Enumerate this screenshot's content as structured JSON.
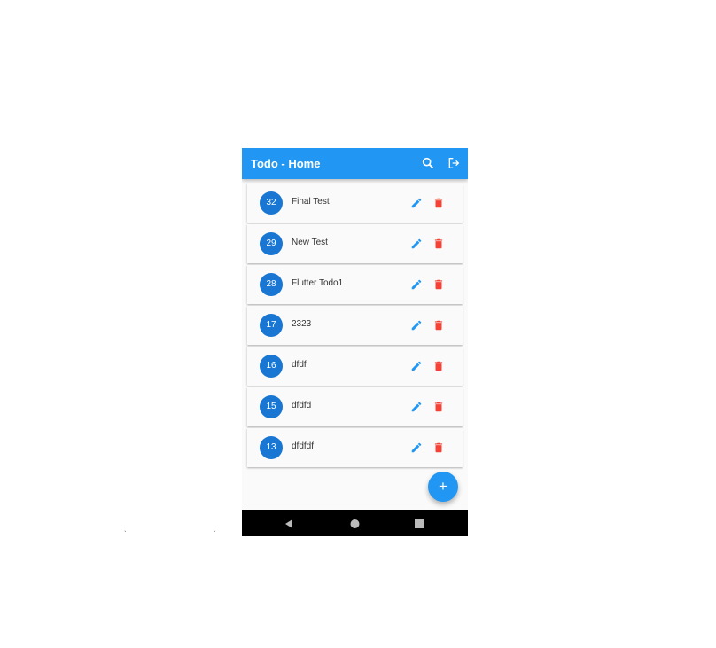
{
  "app_bar": {
    "title": "Todo - Home",
    "icons": [
      "search-icon",
      "logout-icon"
    ]
  },
  "todos": [
    {
      "id": "32",
      "title": "Final Test"
    },
    {
      "id": "29",
      "title": "New Test"
    },
    {
      "id": "28",
      "title": "Flutter Todo1"
    },
    {
      "id": "17",
      "title": "2323"
    },
    {
      "id": "16",
      "title": "dfdf"
    },
    {
      "id": "15",
      "title": "dfdfd"
    },
    {
      "id": "13",
      "title": "dfdfdf"
    }
  ],
  "fab": {
    "label": "+"
  },
  "colors": {
    "primary": "#2196f3",
    "avatar": "#1976d2",
    "delete": "#f44336"
  }
}
